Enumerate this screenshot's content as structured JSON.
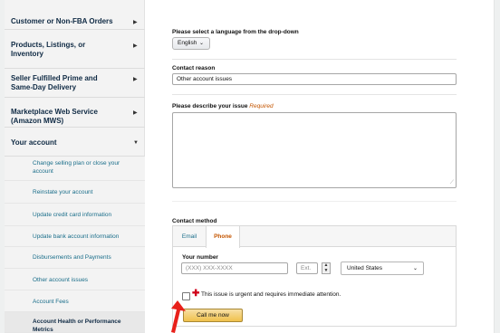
{
  "sidebar": {
    "items": [
      {
        "label": "Customer or Non-FBA Orders",
        "arrow": "▶"
      },
      {
        "label": "Products, Listings, or Inventory",
        "arrow": "▶"
      },
      {
        "label": "Seller Fulfilled Prime and Same-Day Delivery",
        "arrow": "▶"
      },
      {
        "label": "Marketplace Web Service (Amazon MWS)",
        "arrow": "▶"
      },
      {
        "label": "Your account",
        "arrow": "▼"
      }
    ],
    "subitems": [
      {
        "label": "Change selling plan or close your account"
      },
      {
        "label": "Reinstate your account"
      },
      {
        "label": "Update credit card information"
      },
      {
        "label": "Update bank account information"
      },
      {
        "label": "Disbursements and Payments"
      },
      {
        "label": "Other account issues"
      },
      {
        "label": "Account Fees"
      },
      {
        "label": "Account Health or Performance Metrics"
      }
    ]
  },
  "form": {
    "language_label": "Please select a language from the drop-down",
    "language_value": "English",
    "reason_label": "Contact reason",
    "reason_value": "Other account issues",
    "describe_label": "Please describe your issue",
    "describe_required": "Required",
    "contact_method_label": "Contact method",
    "tabs": [
      {
        "label": "Email"
      },
      {
        "label": "Phone"
      }
    ],
    "your_number_label": "Your number",
    "phone_placeholder": "(XXX) XXX-XXXX",
    "ext_placeholder": "Ext.",
    "country_value": "United States",
    "urgent_text": "This issue is urgent and requires immediate attention.",
    "call_button": "Call me now"
  },
  "colors": {
    "accent_orange": "#c45500",
    "link_teal": "#1a6e8a",
    "button_gold": "#f0c14b",
    "urgent_red": "#d0021b",
    "annotation_red": "#e8201a"
  },
  "icons": {
    "urgent": "red-cross-icon",
    "chevron": "chevron-down-icon",
    "annotation": "red-arrow-annotation"
  }
}
